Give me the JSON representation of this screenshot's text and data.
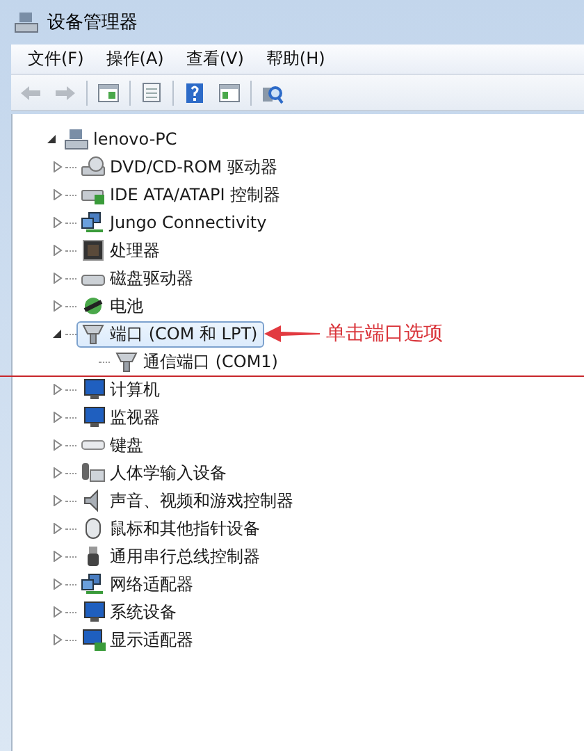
{
  "window": {
    "title": "设备管理器"
  },
  "menu": [
    "文件(F)",
    "操作(A)",
    "查看(V)",
    "帮助(H)"
  ],
  "toolbar": [
    {
      "kind": "back",
      "disabled": true
    },
    {
      "kind": "forward",
      "disabled": true
    },
    {
      "kind": "sep"
    },
    {
      "kind": "console",
      "disabled": false
    },
    {
      "kind": "sep"
    },
    {
      "kind": "properties",
      "disabled": false
    },
    {
      "kind": "sep"
    },
    {
      "kind": "help",
      "disabled": false
    },
    {
      "kind": "pane",
      "disabled": false
    },
    {
      "kind": "sep"
    },
    {
      "kind": "scan",
      "disabled": false
    }
  ],
  "tree": {
    "label": "lenovo-PC",
    "expanded": true,
    "children": [
      {
        "label": "DVD/CD-ROM 驱动器",
        "kind": "drive",
        "expanded": false,
        "selected": false
      },
      {
        "label": "IDE ATA/ATAPI 控制器",
        "kind": "controller",
        "expanded": false,
        "selected": false
      },
      {
        "label": "Jungo Connectivity",
        "kind": "network",
        "expanded": false,
        "selected": false
      },
      {
        "label": "处理器",
        "kind": "chip",
        "expanded": false,
        "selected": false
      },
      {
        "label": "磁盘驱动器",
        "kind": "disk",
        "expanded": false,
        "selected": false
      },
      {
        "label": "电池",
        "kind": "battery",
        "expanded": false,
        "selected": false
      },
      {
        "label": "端口 (COM 和 LPT)",
        "kind": "port",
        "expanded": true,
        "selected": true,
        "annotation": "单击端口选项",
        "children": [
          {
            "label": "通信端口 (COM1)",
            "kind": "port",
            "selected": false
          }
        ]
      },
      {
        "label": "计算机",
        "kind": "monitor",
        "expanded": false,
        "selected": false
      },
      {
        "label": "监视器",
        "kind": "monitor",
        "expanded": false,
        "selected": false
      },
      {
        "label": "键盘",
        "kind": "keyboard",
        "expanded": false,
        "selected": false
      },
      {
        "label": "人体学输入设备",
        "kind": "hid",
        "expanded": false,
        "selected": false
      },
      {
        "label": "声音、视频和游戏控制器",
        "kind": "speaker",
        "expanded": false,
        "selected": false
      },
      {
        "label": "鼠标和其他指针设备",
        "kind": "mouse",
        "expanded": false,
        "selected": false
      },
      {
        "label": "通用串行总线控制器",
        "kind": "usb",
        "expanded": false,
        "selected": false
      },
      {
        "label": "网络适配器",
        "kind": "network",
        "expanded": false,
        "selected": false
      },
      {
        "label": "系统设备",
        "kind": "monitor",
        "expanded": false,
        "selected": false
      },
      {
        "label": "显示适配器",
        "kind": "display",
        "expanded": false,
        "selected": false
      }
    ]
  }
}
